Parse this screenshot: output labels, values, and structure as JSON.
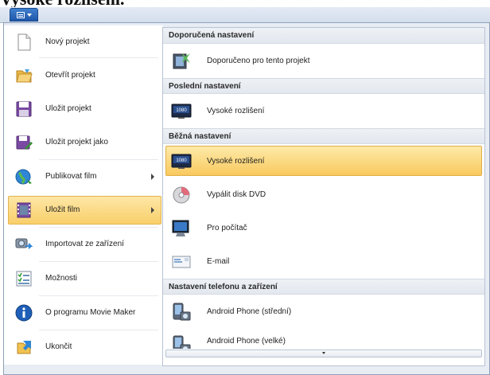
{
  "background_title": "Vysoké rozlišení.",
  "left_menu": [
    {
      "label": "Nový projekt",
      "icon": "new-project-icon",
      "submenu": false
    },
    {
      "label": "Otevřít projekt",
      "icon": "open-folder-icon",
      "submenu": false
    },
    {
      "label": "Uložit projekt",
      "icon": "save-disk-icon",
      "submenu": false
    },
    {
      "label": "Uložit projekt jako",
      "icon": "save-as-icon",
      "submenu": false
    },
    {
      "label": "Publikovat film",
      "icon": "globe-publish-icon",
      "submenu": true
    },
    {
      "label": "Uložit film",
      "icon": "film-save-icon",
      "submenu": true,
      "active": true
    },
    {
      "label": "Importovat ze zařízení",
      "icon": "import-device-icon",
      "submenu": false
    },
    {
      "label": "Možnosti",
      "icon": "options-list-icon",
      "submenu": false
    },
    {
      "label": "O programu Movie Maker",
      "icon": "info-icon",
      "submenu": false
    },
    {
      "label": "Ukončit",
      "icon": "exit-folder-icon",
      "submenu": false
    }
  ],
  "right_menu": {
    "sections": [
      {
        "header": "Doporučená nastavení",
        "items": [
          {
            "label": "Doporučeno pro tento projekt",
            "icon": "recommended-settings-icon"
          }
        ]
      },
      {
        "header": "Poslední nastavení",
        "items": [
          {
            "label": "Vysoké rozlišení",
            "icon": "hd-1080-icon"
          }
        ]
      },
      {
        "header": "Běžná nastavení",
        "items": [
          {
            "label": "Vysoké rozlišení",
            "icon": "hd-1080-icon",
            "active": true
          },
          {
            "label": "Vypálit disk DVD",
            "icon": "dvd-disc-icon"
          },
          {
            "label": "Pro počítač",
            "icon": "computer-monitor-icon"
          },
          {
            "label": "E-mail",
            "icon": "email-envelope-icon"
          }
        ]
      },
      {
        "header": "Nastavení telefonu a zařízení",
        "items": [
          {
            "label": "Android Phone (střední)",
            "icon": "phone-device-icon"
          },
          {
            "label": "Android Phone (velké)",
            "icon": "phone-device-icon"
          }
        ]
      }
    ],
    "hd_badge": "1080"
  },
  "colors": {
    "highlight_top": "#fde7a6",
    "highlight_bottom": "#f9cf6a",
    "accent_blue": "#1f57a8"
  }
}
